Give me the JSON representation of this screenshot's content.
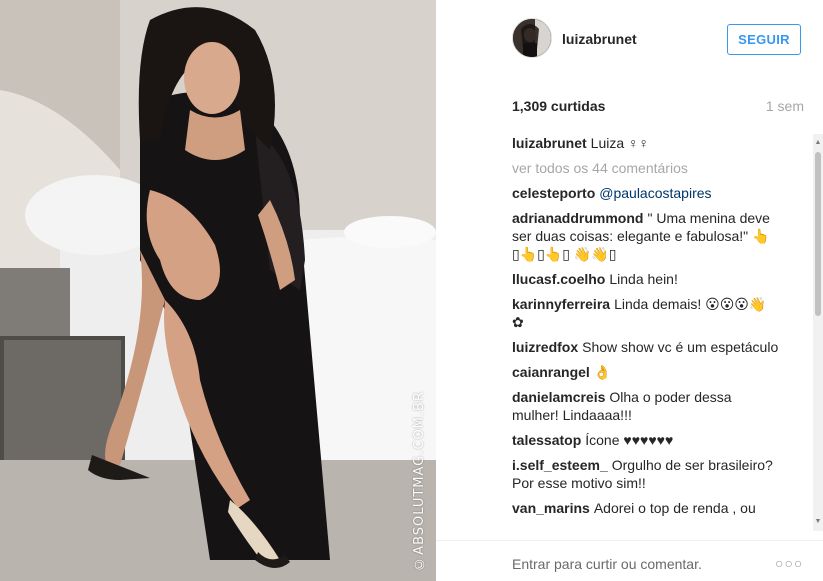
{
  "photo": {
    "watermark": "©ABSOLUTMAG.COM.BR"
  },
  "header": {
    "username": "luizabrunet",
    "follow_label": "SEGUIR"
  },
  "stats": {
    "likes": "1,309 curtidas",
    "age": "1 sem"
  },
  "caption": {
    "author": "luizabrunet",
    "text": "Luiza ♀♀"
  },
  "view_all": "ver todos os 44 comentários",
  "comments": [
    {
      "author": "celesteporto",
      "text": "@paulacostapires",
      "mention": true
    },
    {
      "author": "adrianaddrummond",
      "text": "\" Uma menina deve ser duas coisas: elegante e fabulosa!\" 👆 ▯👆▯👆▯ 👋👋▯"
    },
    {
      "author": "llucasf.coelho",
      "text": "Linda hein!"
    },
    {
      "author": "karinnyferreira",
      "text": "Linda demais! 😮😮😮👋 ✿"
    },
    {
      "author": "luizredfox",
      "text": "Show show vc é um espetáculo"
    },
    {
      "author": "caianrangel",
      "text": "👌"
    },
    {
      "author": "danielamcreis",
      "text": "Olha o poder dessa mulher! Lindaaaa!!!"
    },
    {
      "author": "talessatop",
      "text": "Ícone ♥♥♥♥♥♥"
    },
    {
      "author": "i.self_esteem_",
      "text": "Orgulho de ser brasileiro? Por esse motivo sim!!"
    },
    {
      "author": "van_marins",
      "text": "Adorei o top de renda , ou"
    }
  ],
  "footer": {
    "comment_placeholder": "Entrar para curtir ou comentar.",
    "more_icon": "more-options-icon",
    "more_glyph": "○○○"
  },
  "colors": {
    "accent_blue": "#3897f0",
    "muted_gray": "#a5a7aa",
    "mention_blue": "#003569",
    "text": "#262626"
  }
}
